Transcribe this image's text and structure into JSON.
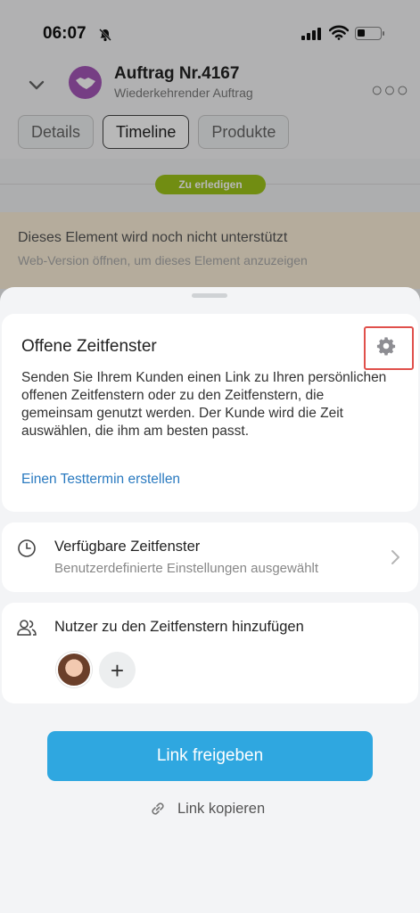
{
  "status_bar": {
    "time": "06:07"
  },
  "header": {
    "title": "Auftrag Nr.4167",
    "subtitle": "Wiederkehrender Auftrag",
    "more_icon": "more-horizontal-icon"
  },
  "tabs": [
    {
      "label": "Details",
      "active": false
    },
    {
      "label": "Timeline",
      "active": true
    },
    {
      "label": "Produkte",
      "active": false
    }
  ],
  "timeline": {
    "pill": "Zu erledigen",
    "unsupported_title": "Dieses Element wird noch nicht unterstützt",
    "unsupported_sub": "Web-Version öffnen, um dieses Element anzuzeigen"
  },
  "sheet": {
    "main_card": {
      "title": "Offene Zeitfenster",
      "description": "Senden Sie Ihrem Kunden einen Link zu Ihren persönlichen offenen Zeitfenstern oder zu den Zeitfenstern, die gemeinsam genutzt werden. Der Kunde wird die Zeit auswählen, die ihm am besten passt.",
      "link": "Einen Testtermin erstellen"
    },
    "slots_card": {
      "title": "Verfügbare Zeitfenster",
      "subtitle": "Benutzerdefinierte Einstellungen ausgewählt"
    },
    "users_card": {
      "title": "Nutzer zu den Zeitfenstern hinzufügen",
      "add_symbol": "+"
    },
    "share_button": "Link freigeben",
    "copy_link": "Link kopieren"
  },
  "colors": {
    "accent_blue": "#2fa7e0",
    "link_blue": "#2a7ac0",
    "todo_green": "#9dc41a",
    "avatar_purple": "#a457b8",
    "highlight_red": "#e0504b"
  }
}
